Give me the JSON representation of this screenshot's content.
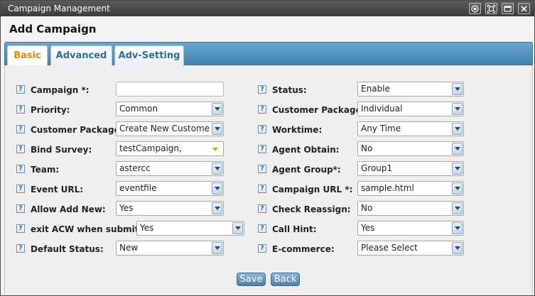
{
  "window": {
    "title": "Campaign Management"
  },
  "heading": "Add Campaign",
  "tabs": [
    {
      "label": "Basic",
      "active": true
    },
    {
      "label": "Advanced",
      "active": false
    },
    {
      "label": "Adv-Setting",
      "active": false
    }
  ],
  "left": [
    {
      "label": "Campaign *:",
      "value": "",
      "kind": "text"
    },
    {
      "label": "Priority:",
      "value": "Common",
      "kind": "select"
    },
    {
      "label": "Customer Package:",
      "value": "Create New Custome",
      "kind": "select"
    },
    {
      "label": "Bind Survey:",
      "value": "testCampaign,",
      "kind": "combo"
    },
    {
      "label": "Team:",
      "value": "astercc",
      "kind": "select"
    },
    {
      "label": "Event URL:",
      "value": "eventfile",
      "kind": "select"
    },
    {
      "label": "Allow Add New:",
      "value": "Yes",
      "kind": "select"
    },
    {
      "label": "exit ACW when submit:",
      "value": "Yes",
      "kind": "select"
    },
    {
      "label": "Default Status:",
      "value": "New",
      "kind": "select"
    }
  ],
  "right": [
    {
      "label": "Status:",
      "value": "Enable",
      "kind": "select"
    },
    {
      "label": "Customer Package:",
      "value": "Individual",
      "kind": "select"
    },
    {
      "label": "Worktime:",
      "value": "Any Time",
      "kind": "select"
    },
    {
      "label": "Agent Obtain:",
      "value": "No",
      "kind": "select"
    },
    {
      "label": "Agent Group*:",
      "value": "Group1",
      "kind": "select"
    },
    {
      "label": "Campaign URL *:",
      "value": "sample.html",
      "kind": "select"
    },
    {
      "label": "Check Reassign:",
      "value": "No",
      "kind": "select"
    },
    {
      "label": "Call Hint:",
      "value": "Yes",
      "kind": "select"
    },
    {
      "label": "E-commerce:",
      "value": "Please Select",
      "kind": "select"
    }
  ],
  "buttons": {
    "save": "Save",
    "back": "Back"
  },
  "help_glyph": "?",
  "colors": {
    "tabbar": "#3f82b3",
    "active_tab_text": "#e68a00",
    "button": "#4f7fae"
  }
}
